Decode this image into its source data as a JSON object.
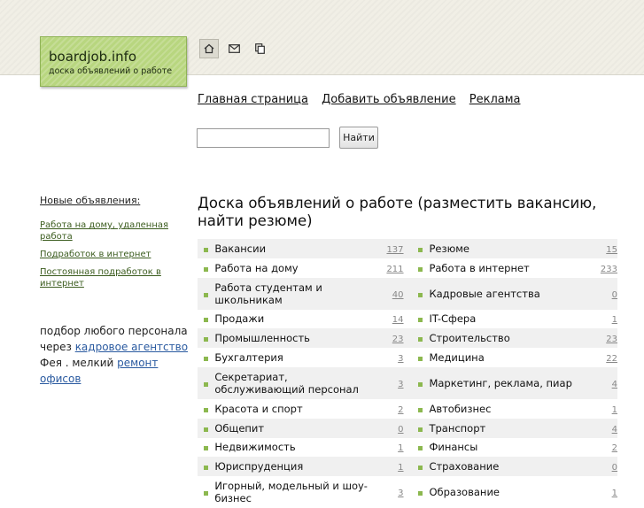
{
  "header": {
    "logo_title": "boardjob.info",
    "logo_subtitle": "доска объявлений о работе",
    "icons": [
      "home-icon",
      "mail-icon",
      "copy-icon"
    ]
  },
  "nav": {
    "home": "Главная страница",
    "add": "Добавить объявление",
    "ads": "Реклама"
  },
  "search": {
    "placeholder": "",
    "button": "Найти"
  },
  "sidebar": {
    "heading": "Новые объявления:",
    "items": [
      "Работа на дому, удаленная работа",
      "Подработок в интернет",
      "Постоянная подработок в интернет"
    ],
    "promo_text1": "подбор любого персонала через",
    "promo_link1": "кадровое агентство",
    "promo_text2": "Фея . мелкий",
    "promo_link2": "ремонт офисов"
  },
  "main": {
    "heading": "Доска объявлений о работе (разместить вакансию, найти резюме)"
  },
  "categories": [
    {
      "left": "Вакансии",
      "left_count": "137",
      "right": "Резюме",
      "right_count": "15"
    },
    {
      "left": "Работа на дому",
      "left_count": "211",
      "right": "Работа в интернет",
      "right_count": "233"
    },
    {
      "left": "Работа студентам и школьникам",
      "left_count": "40",
      "right": "Кадровые агентства",
      "right_count": "0"
    },
    {
      "left": "Продажи",
      "left_count": "14",
      "right": "IT-Сфера",
      "right_count": "1"
    },
    {
      "left": "Промышленность",
      "left_count": "23",
      "right": "Строительство",
      "right_count": "23"
    },
    {
      "left": "Бухгалтерия",
      "left_count": "3",
      "right": "Медицина",
      "right_count": "22"
    },
    {
      "left": "Секретариат, обслуживающий персонал",
      "left_count": "3",
      "right": "Маркетинг, реклама, пиар",
      "right_count": "4"
    },
    {
      "left": "Красота и спорт",
      "left_count": "2",
      "right": "Автобизнес",
      "right_count": "1"
    },
    {
      "left": "Общепит",
      "left_count": "0",
      "right": "Транспорт",
      "right_count": "4"
    },
    {
      "left": "Недвижимость",
      "left_count": "1",
      "right": "Финансы",
      "right_count": "2"
    },
    {
      "left": "Юриспруденция",
      "left_count": "1",
      "right": "Страхование",
      "right_count": "0"
    },
    {
      "left": "Игорный, модельный и шоу-бизнес",
      "left_count": "3",
      "right": "Образование",
      "right_count": "1"
    }
  ],
  "colors": {
    "accent": "#b8d67f",
    "bullet": "#8cb84f"
  }
}
